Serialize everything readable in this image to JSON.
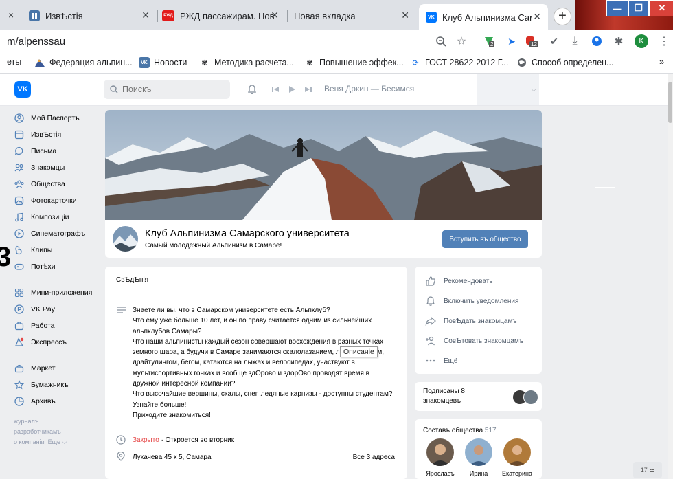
{
  "browser": {
    "tabs": [
      {
        "title": "ИзвѢстія",
        "favicon_color": "#4a76a8",
        "favicon_glyph": "▮▮"
      },
      {
        "title": "РЖД пассажирам. Нов",
        "favicon_color": "#e21a1a",
        "favicon_glyph": "РЖД"
      },
      {
        "title": "Новая вкладка",
        "favicon_color": "",
        "favicon_glyph": ""
      },
      {
        "title": "Клуб Альпинизма Сам",
        "favicon_color": "#0077ff",
        "favicon_glyph": "VK"
      }
    ],
    "first_tab_close": "×",
    "url": "m/alpenssau",
    "profile_initial": "K",
    "badge_counts": {
      "ext1": "2",
      "ext2": "12"
    },
    "bookmarks": [
      "еты",
      "Федерация альпин...",
      "Новости",
      "Методика расчета...",
      "Повышение эффек...",
      "ГОСТ 28622-2012 Г...",
      "Способ определен..."
    ],
    "bookmarks_more": "»"
  },
  "vk": {
    "logo": "VK",
    "search_placeholder": "Поискъ",
    "player_track": "Веня Дркин — Бесимся",
    "sidebar": [
      {
        "label": "Мой Паспортъ",
        "icon": "user-circle-icon"
      },
      {
        "label": "ИзвѢстія",
        "icon": "news-icon"
      },
      {
        "label": "Письма",
        "icon": "message-icon"
      },
      {
        "label": "Знакомцы",
        "icon": "friends-icon"
      },
      {
        "label": "Общества",
        "icon": "groups-icon"
      },
      {
        "label": "Фотокарточки",
        "icon": "photo-icon"
      },
      {
        "label": "Композиціи",
        "icon": "music-icon"
      },
      {
        "label": "Синематографъ",
        "icon": "video-icon"
      },
      {
        "label": "Клипы",
        "icon": "clips-icon"
      },
      {
        "label": "Потѣхи",
        "icon": "gamepad-icon"
      }
    ],
    "sidebar2": [
      {
        "label": "Мини-приложения",
        "icon": "apps-icon"
      },
      {
        "label": "VK Pay",
        "icon": "pay-icon"
      },
      {
        "label": "Работа",
        "icon": "work-icon"
      },
      {
        "label": "Экспрессъ",
        "icon": "express-icon"
      }
    ],
    "sidebar3": [
      {
        "label": "Маркет",
        "icon": "bag-icon"
      },
      {
        "label": "Бумажникъ",
        "icon": "star-icon"
      },
      {
        "label": "Архивъ",
        "icon": "archive-icon"
      }
    ],
    "footer": {
      "journal": "журналъ",
      "devs": "разработчикамъ",
      "about": "о компаніи",
      "more": "Еще ⌵"
    },
    "group": {
      "name": "Клуб Альпинизма Самарского университета",
      "status": "Самый молодежный Альпинизм в Самаре!",
      "join_label": "Вступить въ общество"
    },
    "info": {
      "title": "СвѢдѢнія",
      "description": "Знаете ли вы, что в Самарском университете есть Альпклуб?\nЧто ему уже больше 10 лет, и он по праву считается одним из сильнейших альпклубов Самары?\nЧто наши альпинисты каждый сезон совершают восхождения в разных точках земного шара, а будучи в Самаре занимаются скалолазанием, ледолазанием, драйтулингом, бегом, катаются на лыжах и велосипедах, участвуют в мультиспортивных гонках и вообще здОрово и здорОво проводят время в дружной интересной компании?\nЧто высочайшие вершины, скалы, снег, ледяные карнизы - доступны студентам?\nУзнайте больше!\nПриходите знакомиться!",
      "tooltip": "Описаніе",
      "status_closed": "Закрыто",
      "status_opens": " · Откроется во вторник",
      "address": "Лукачева 45 к 5, Самара",
      "all_addresses": "Все 3 адреса"
    },
    "actions": [
      {
        "label": "Рекомендовать",
        "icon": "thumbs-up-icon"
      },
      {
        "label": "Включить уведомления",
        "icon": "bell-icon"
      },
      {
        "label": "ПовѢдать знакомцамъ",
        "icon": "share-icon"
      },
      {
        "label": "СовѢтовать знакомцамъ",
        "icon": "add-friend-icon"
      },
      {
        "label": "Ещё",
        "icon": "more-icon"
      }
    ],
    "subscribed": {
      "text": "Подписаны 8 знакомцевъ"
    },
    "members": {
      "title": "Составъ общества",
      "count": "517",
      "list": [
        "Ярославъ",
        "Ирина",
        "Екатерина"
      ]
    },
    "chat_badge": "17 ⚍",
    "edge_digit": "3"
  }
}
